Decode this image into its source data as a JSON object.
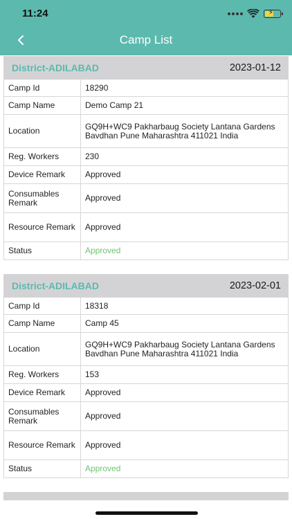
{
  "status_bar": {
    "time": "11:24"
  },
  "header": {
    "title": "Camp List",
    "back_icon": "chevron-left-icon"
  },
  "labels": {
    "camp_id": "Camp Id",
    "camp_name": "Camp Name",
    "location": "Location",
    "reg_workers": "Reg. Workers",
    "device_remark": "Device Remark",
    "consumables_remark": "Consumables Remark",
    "resource_remark": "Resource Remark",
    "status": "Status"
  },
  "camps": [
    {
      "district": "District-ADILABAD",
      "date": "2023-01-12",
      "camp_id": "18290",
      "camp_name": "Demo Camp 21",
      "location": "GQ9H+WC9 Pakharbaug Society Lantana Gardens Bavdhan Pune Maharashtra 411021 India",
      "reg_workers": "230",
      "device_remark": "Approved",
      "consumables_remark": "Approved",
      "resource_remark": "Approved",
      "status": "Approved"
    },
    {
      "district": "District-ADILABAD",
      "date": "2023-02-01",
      "camp_id": "18318",
      "camp_name": "Camp 45",
      "location": "GQ9H+WC9 Pakharbaug Society Lantana Gardens Bavdhan Pune Maharashtra 411021 India",
      "reg_workers": "153",
      "device_remark": "Approved",
      "consumables_remark": "Approved",
      "resource_remark": "Approved",
      "status": "Approved"
    }
  ],
  "colors": {
    "accent": "#5cb9ae",
    "status_approved": "#6cc46c",
    "card_header": "#d3d3d6"
  }
}
